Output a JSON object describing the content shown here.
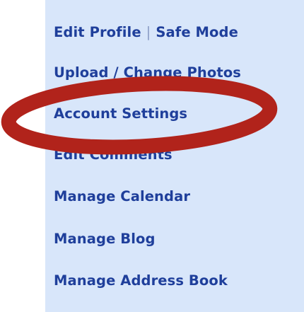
{
  "menu": {
    "edit_profile": "Edit Profile",
    "separator": "|",
    "safe_mode": "Safe Mode",
    "upload_photos": "Upload / Change Photos",
    "account_settings": "Account Settings",
    "edit_comments": "Edit Comments",
    "manage_calendar": "Manage Calendar",
    "manage_blog": "Manage Blog",
    "manage_address_book": "Manage Address Book"
  },
  "colors": {
    "panel_background": "#d8e6fa",
    "link_text": "#1f3f9b",
    "highlight_ellipse": "#b1231b"
  }
}
